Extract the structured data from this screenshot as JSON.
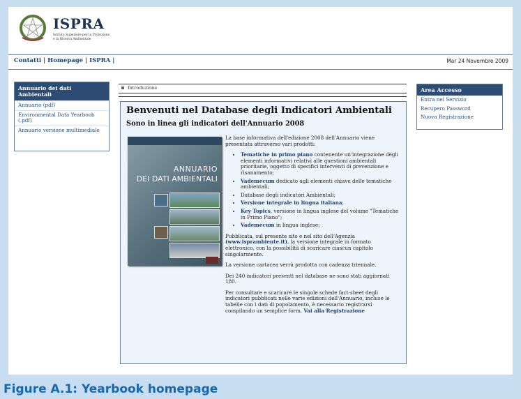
{
  "header": {
    "org_name": "ISPRA",
    "org_sub_line1": "Istituto Superiore per la Protezione",
    "org_sub_line2": "e la Ricerca Ambientale",
    "links": [
      "Contatti",
      "Homepage",
      "ISPRA"
    ],
    "date": "Mar 24 Novembre 2009"
  },
  "left_menu": {
    "title": "Annuario dei dati Ambientali",
    "items": [
      "Annuario (pdf)",
      "Environmental Data Yearbook (.pdf)",
      "Annuario versione multimediale"
    ]
  },
  "right_menu": {
    "title": "Area Accesso",
    "items": [
      "Entra nel Servizio",
      "Recupero Password",
      "Nuova Registrazione"
    ]
  },
  "breadcrumb": "Introduzione",
  "main": {
    "title": "Benvenuti nel Database degli Indicatori Ambientali",
    "subtitle": "Sono in linea gli indicatori dell'Annuario 2008",
    "cover_title_1": "ANNUARIO",
    "cover_title_2": "DEI DATI AMBIENTALI",
    "intro": "La base informativa dell'edizione 2008 dell'Annuario viene presentata attraverso vari prodotti:",
    "products": [
      {
        "bold": "Tematiche in primo piano",
        "rest": " contenente un'integrazione degli elementi informativi relativi alle questioni ambientali prioritarie, oggetto di specifici interventi di prevenzione e risanamento;"
      },
      {
        "bold": "Vademecum",
        "rest": " dedicato agli elementi chiave delle tematiche ambientali;"
      },
      {
        "bold": "",
        "rest": "Database degli indicatori Ambientali;"
      },
      {
        "bold": "Versione integrale in lingua italiana",
        "rest": ";"
      },
      {
        "bold": "Key Topics",
        "rest": ", versione in lingua inglese del volume \"Tematiche in Primo Piano\";"
      },
      {
        "bold": "Vademecum",
        "rest": " in lingua inglese;"
      }
    ],
    "para1_a": "Pubblicata, sul presente sito e nel sito dell'Agenzia",
    "para1_link": "(www.isprambiente.it)",
    "para1_b": ", la versione integrale in formato elettronico, con la possibilità di scaricare ciascun capitolo singolarmente.",
    "para2": "La versione cartacea verrà prodotta con cadenza triennale.",
    "para3": "Dei 240 indicatori presenti nel database ne sono stati aggiornati 180.",
    "para4": "Per consultare e scaricare le singole schede fact-sheet degli indicatori pubblicati nelle varie edizioni dell'Annuario, incluse le tabelle con i dati di popolamento, è necessario registrarsi compilando un semplice form.",
    "para4_link": "Vai alla Registrazione"
  },
  "caption": "Figure A.1: Yearbook homepage"
}
